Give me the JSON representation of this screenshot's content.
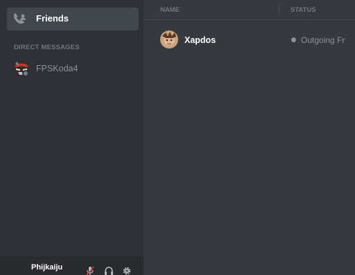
{
  "sidebar": {
    "friends": {
      "label": "Friends",
      "icon": "friends-icon"
    },
    "dm_header": "DIRECT MESSAGES",
    "direct_messages": [
      {
        "name": "FPSKoda4",
        "status": "offline",
        "status_color": "#747f8d"
      }
    ]
  },
  "user_panel": {
    "username": "Phijkaiju",
    "icons": [
      "microphone-icon",
      "headset-icon",
      "gear-icon"
    ]
  },
  "friends_table": {
    "columns": {
      "name": "NAME",
      "status": "STATUS"
    },
    "rows": [
      {
        "name": "Xapdos",
        "status": "Outgoing Fr"
      }
    ]
  },
  "colors": {
    "background": "#36393e",
    "sidebar": "#2f3136",
    "user_panel": "#292b2f",
    "selected_item": "#42464d",
    "muted_text": "#72767d"
  }
}
